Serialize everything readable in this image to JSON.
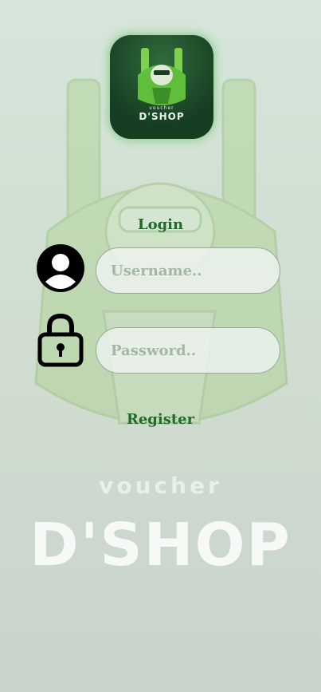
{
  "background": {
    "word_voucher": "voucher",
    "word_brand": "D'SHOP"
  },
  "app_icon": {
    "voucher": "voucher",
    "name": "D'SHOP"
  },
  "form": {
    "title": "Login",
    "username_placeholder": "Username..",
    "password_placeholder": "Password..",
    "register_label": "Register"
  },
  "icons": {
    "user": "user-circle-icon",
    "lock": "lock-icon"
  },
  "colors": {
    "accent": "#1f6a2c",
    "background": "#d2e0d4",
    "glow": "#6ec86e"
  }
}
